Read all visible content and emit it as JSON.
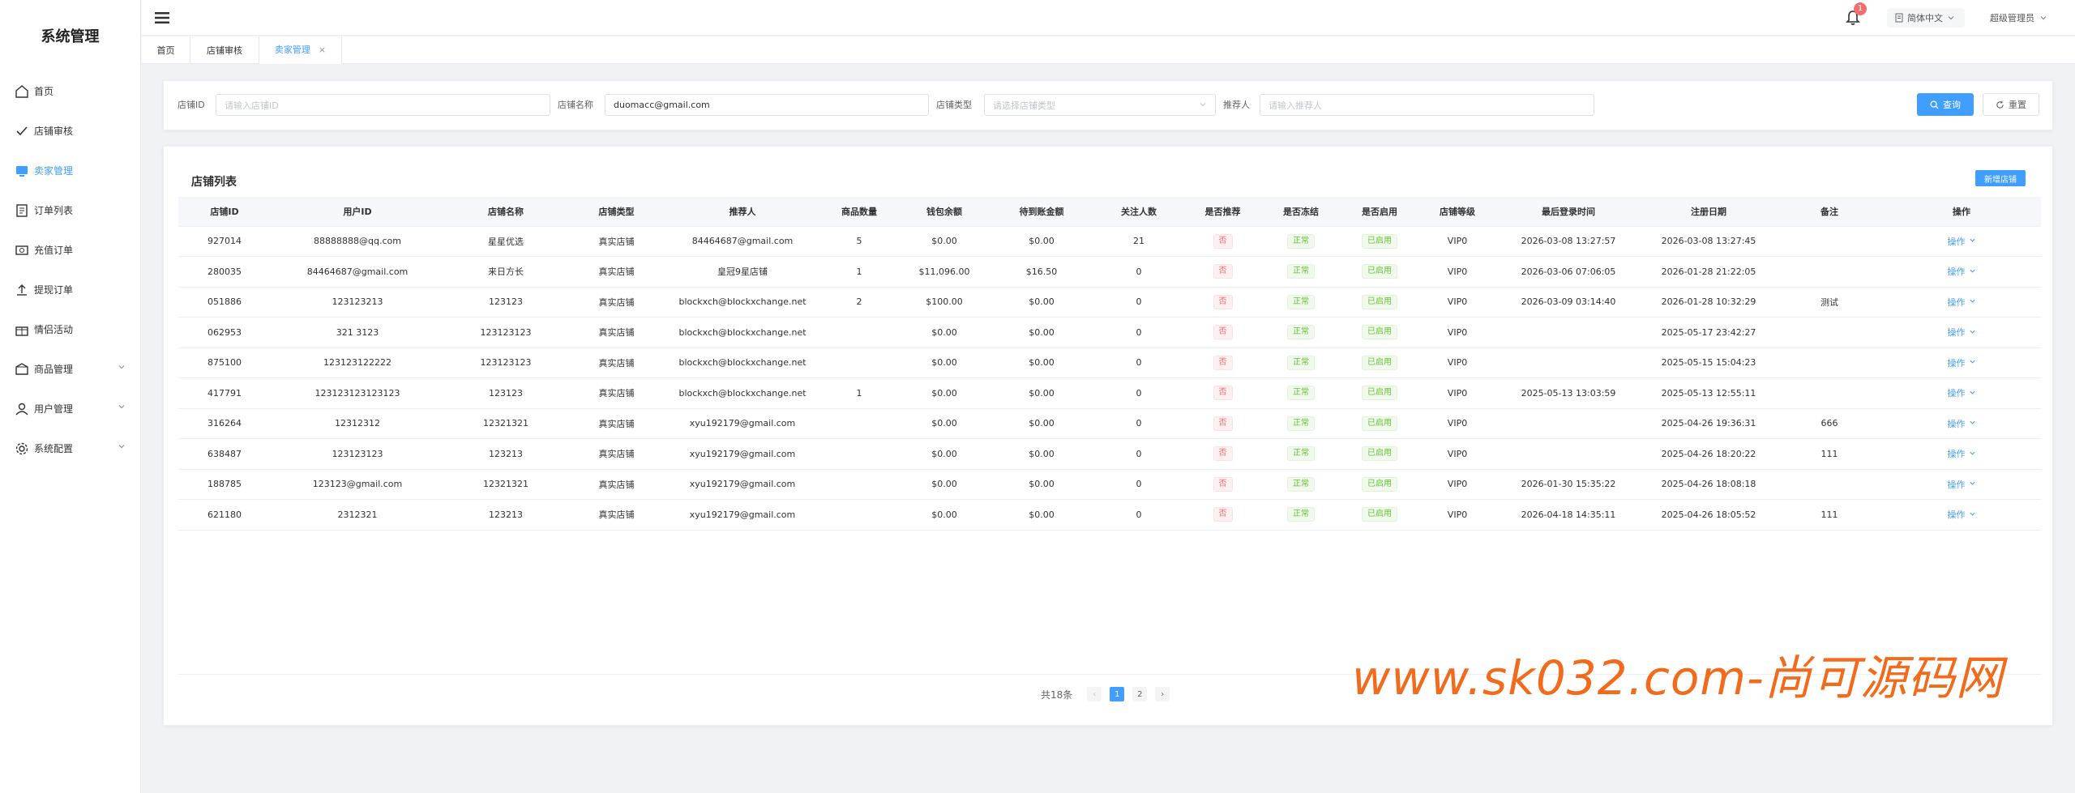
{
  "app": {
    "title": "系统管理"
  },
  "sidebar": {
    "items": [
      {
        "label": "首页",
        "icon": "home-icon",
        "active": false,
        "expandable": false
      },
      {
        "label": "店铺审核",
        "icon": "check-icon",
        "active": false,
        "expandable": false
      },
      {
        "label": "卖家管理",
        "icon": "seller-icon",
        "active": true,
        "expandable": false
      },
      {
        "label": "订单列表",
        "icon": "order-list-icon",
        "active": false,
        "expandable": false
      },
      {
        "label": "充值订单",
        "icon": "recharge-icon",
        "active": false,
        "expandable": false
      },
      {
        "label": "提现订单",
        "icon": "withdraw-icon",
        "active": false,
        "expandable": false
      },
      {
        "label": "情侣活动",
        "icon": "gift-icon",
        "active": false,
        "expandable": false
      },
      {
        "label": "商品管理",
        "icon": "goods-icon",
        "active": false,
        "expandable": true
      },
      {
        "label": "用户管理",
        "icon": "user-icon",
        "active": false,
        "expandable": true
      },
      {
        "label": "系统配置",
        "icon": "gear-icon",
        "active": false,
        "expandable": true
      }
    ]
  },
  "header": {
    "notification_count": "1",
    "language": "简体中文",
    "user": "超级管理员"
  },
  "tabs": [
    {
      "label": "首页",
      "active": false,
      "closable": false
    },
    {
      "label": "店铺审核",
      "active": false,
      "closable": false
    },
    {
      "label": "卖家管理",
      "active": true,
      "closable": true
    }
  ],
  "search": {
    "shop_id_label": "店铺ID",
    "shop_id_placeholder": "请输入店铺ID",
    "shop_name_label": "店铺名称",
    "shop_name_value": "duomacc@gmail.com",
    "shop_type_label": "店铺类型",
    "shop_type_placeholder": "请选择店铺类型",
    "referrer_label": "推荐人",
    "referrer_placeholder": "请输入推荐人",
    "query_label": "查询",
    "reset_label": "重置"
  },
  "list": {
    "title": "店铺列表",
    "add_label": "新增店铺",
    "columns": [
      "店铺ID",
      "用户ID",
      "店铺名称",
      "店铺类型",
      "推荐人",
      "商品数量",
      "钱包余额",
      "待到账金额",
      "关注人数",
      "是否推荐",
      "是否冻结",
      "是否启用",
      "店铺等级",
      "最后登录时间",
      "注册日期",
      "备注",
      "操作"
    ],
    "rows": [
      [
        "927014",
        "88888888@qq.com",
        "星星优选",
        "真实店铺",
        "84464687@gmail.com",
        "5",
        "$0.00",
        "$0.00",
        "21",
        "否",
        "正常",
        "已启用",
        "VIP0",
        "2026-03-08 13:27:57",
        "2026-03-08 13:27:45",
        "",
        "操作"
      ],
      [
        "280035",
        "84464687@gmail.com",
        "来日方长",
        "真实店铺",
        "皇冠9星店铺",
        "1",
        "$11,096.00",
        "$16.50",
        "0",
        "否",
        "正常",
        "已启用",
        "VIP0",
        "2026-03-06 07:06:05",
        "2026-01-28 21:22:05",
        "",
        "操作"
      ],
      [
        "051886",
        "123123213",
        "123123",
        "真实店铺",
        "blockxch@blockxchange.net",
        "2",
        "$100.00",
        "$0.00",
        "0",
        "否",
        "正常",
        "已启用",
        "VIP0",
        "2026-03-09 03:14:40",
        "2026-01-28 10:32:29",
        "测试",
        "操作"
      ],
      [
        "062953",
        "321 3123",
        "123123123",
        "真实店铺",
        "blockxch@blockxchange.net",
        "",
        "$0.00",
        "$0.00",
        "0",
        "否",
        "正常",
        "已启用",
        "VIP0",
        "",
        "2025-05-17 23:42:27",
        "",
        "操作"
      ],
      [
        "875100",
        "123123122222",
        "123123123",
        "真实店铺",
        "blockxch@blockxchange.net",
        "",
        "$0.00",
        "$0.00",
        "0",
        "否",
        "正常",
        "已启用",
        "VIP0",
        "",
        "2025-05-15 15:04:23",
        "",
        "操作"
      ],
      [
        "417791",
        "123123123123123",
        "123123",
        "真实店铺",
        "blockxch@blockxchange.net",
        "1",
        "$0.00",
        "$0.00",
        "0",
        "否",
        "正常",
        "已启用",
        "VIP0",
        "2025-05-13 13:03:59",
        "2025-05-13 12:55:11",
        "",
        "操作"
      ],
      [
        "316264",
        "12312312",
        "12321321",
        "真实店铺",
        "xyu192179@gmail.com",
        "",
        "$0.00",
        "$0.00",
        "0",
        "否",
        "正常",
        "已启用",
        "VIP0",
        "",
        "2025-04-26 19:36:31",
        "666",
        "操作"
      ],
      [
        "638487",
        "123123123",
        "123213",
        "真实店铺",
        "xyu192179@gmail.com",
        "",
        "$0.00",
        "$0.00",
        "0",
        "否",
        "正常",
        "已启用",
        "VIP0",
        "",
        "2025-04-26 18:20:22",
        "111",
        "操作"
      ],
      [
        "188785",
        "123123@gmail.com",
        "12321321",
        "真实店铺",
        "xyu192179@gmail.com",
        "",
        "$0.00",
        "$0.00",
        "0",
        "否",
        "正常",
        "已启用",
        "VIP0",
        "2026-01-30 15:35:22",
        "2025-04-26 18:08:18",
        "",
        "操作"
      ],
      [
        "621180",
        "2312321",
        "123213",
        "真实店铺",
        "xyu192179@gmail.com",
        "",
        "$0.00",
        "$0.00",
        "0",
        "否",
        "正常",
        "已启用",
        "VIP0",
        "2026-04-18 14:35:11",
        "2025-04-26 18:05:52",
        "111",
        "操作"
      ]
    ]
  },
  "pagination": {
    "total_text": "共18条",
    "pages": [
      "1",
      "2"
    ],
    "current": "1"
  },
  "watermark": "www.sk032.com-尚可源码网",
  "colors": {
    "primary": "#409eff",
    "danger": "#f56c6c",
    "success": "#67c23a",
    "watermark": "#f26b1d"
  }
}
